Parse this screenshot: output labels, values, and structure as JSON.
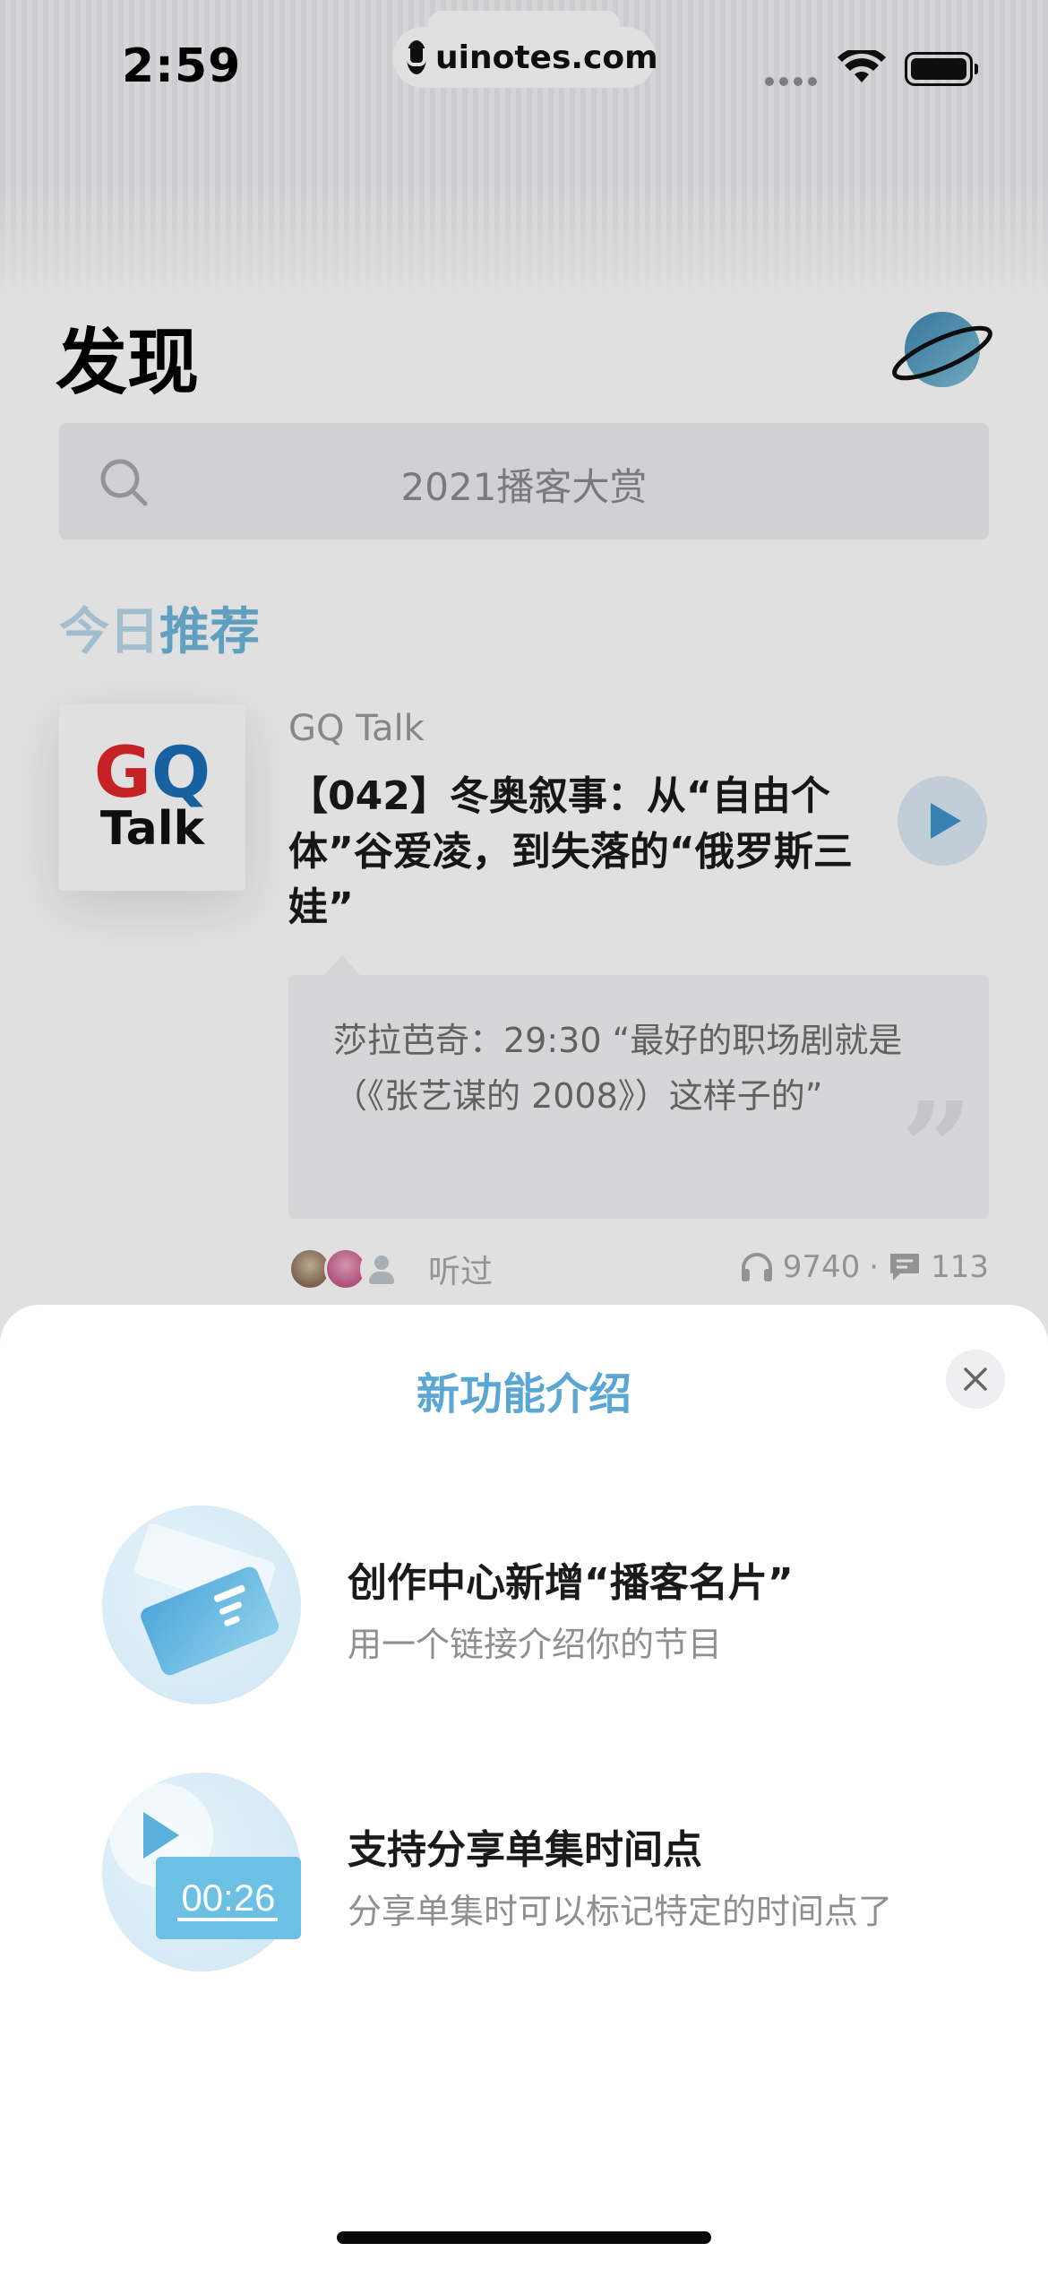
{
  "status_bar": {
    "time": "2:59",
    "watermark": "uinotes.com"
  },
  "header": {
    "title": "发现",
    "planet_icon": "planet-icon"
  },
  "search": {
    "placeholder": "2021播客大赏"
  },
  "recommendation": {
    "heading_part1": "今日",
    "heading_part2": "推荐",
    "cover": {
      "line1_g": "G",
      "line1_q": "Q",
      "line2": "Talk"
    },
    "podcast_name": "GQ Talk",
    "episode_title": "【042】冬奥叙事：从“自由个体”谷爱凌，到失落的“俄罗斯三娃”",
    "quote": "莎拉芭奇：29:30 “最好的职场剧就是（《张艺谋的 2008》）这样子的”",
    "quote_mark": "”",
    "listened_label": "听过",
    "plays": "9740",
    "separator": "·",
    "comments": "113"
  },
  "sheet": {
    "title": "新功能介绍",
    "features": [
      {
        "title": "创作中心新增“播客名片”",
        "description": "用一个链接介绍你的节目"
      },
      {
        "title": "支持分享单集时间点",
        "description": "分享单集时可以标记特定的时间点了",
        "timestamp": "00:26"
      }
    ]
  },
  "colors": {
    "accent": "#5aa7d3",
    "play_accent": "#3e95cc",
    "gq_red": "#e2262b",
    "gq_blue": "#1b6fb8"
  }
}
